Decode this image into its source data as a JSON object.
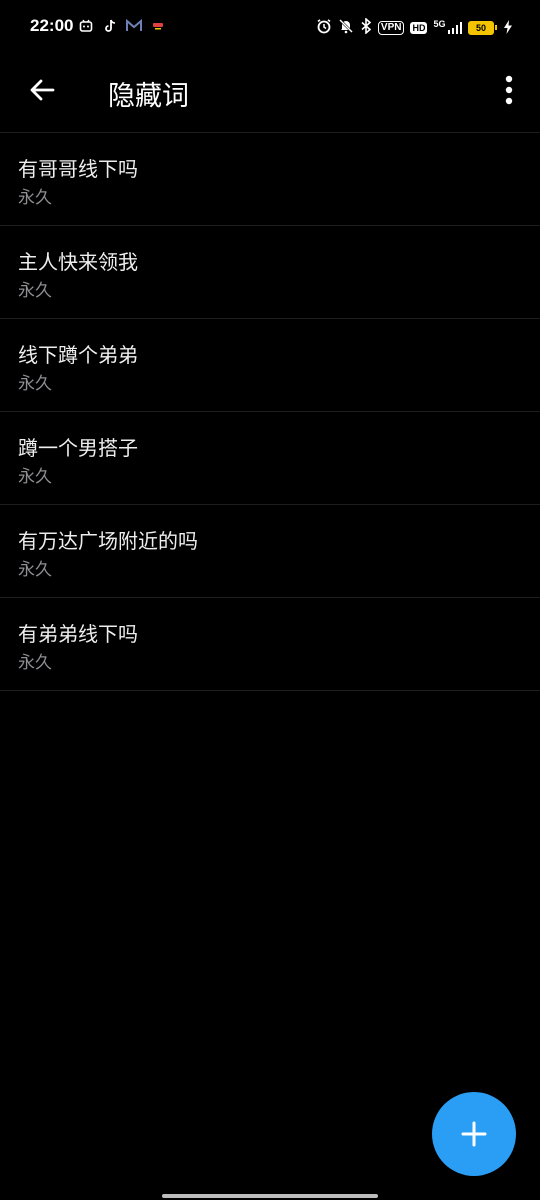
{
  "status_bar": {
    "time": "22:00",
    "vpn_label": "VPN",
    "hd_label": "HD",
    "network_label": "5G",
    "battery_level": "50",
    "left_icons": [
      "app-notification-icon",
      "tiktok-icon",
      "mail-icon",
      "cast-icon"
    ],
    "right_icons": [
      "alarm-icon",
      "mute-icon",
      "bluetooth-icon",
      "signal-icon",
      "charging-icon"
    ],
    "battery_color": "#f5c400"
  },
  "appbar": {
    "title": "隐藏词",
    "back_icon": "arrow-left-icon",
    "more_icon": "more-vertical-icon"
  },
  "items": [
    {
      "word": "有哥哥线下吗",
      "duration": "永久"
    },
    {
      "word": "主人快来领我",
      "duration": "永久"
    },
    {
      "word": "线下蹲个弟弟",
      "duration": "永久"
    },
    {
      "word": "蹲一个男搭子",
      "duration": "永久"
    },
    {
      "word": "有万达广场附近的吗",
      "duration": "永久"
    },
    {
      "word": "有弟弟线下吗",
      "duration": "永久"
    }
  ],
  "fab": {
    "icon": "plus-icon",
    "color": "#2a9df4"
  },
  "colors": {
    "background": "#000000",
    "secondary_text": "#8e8e93"
  }
}
